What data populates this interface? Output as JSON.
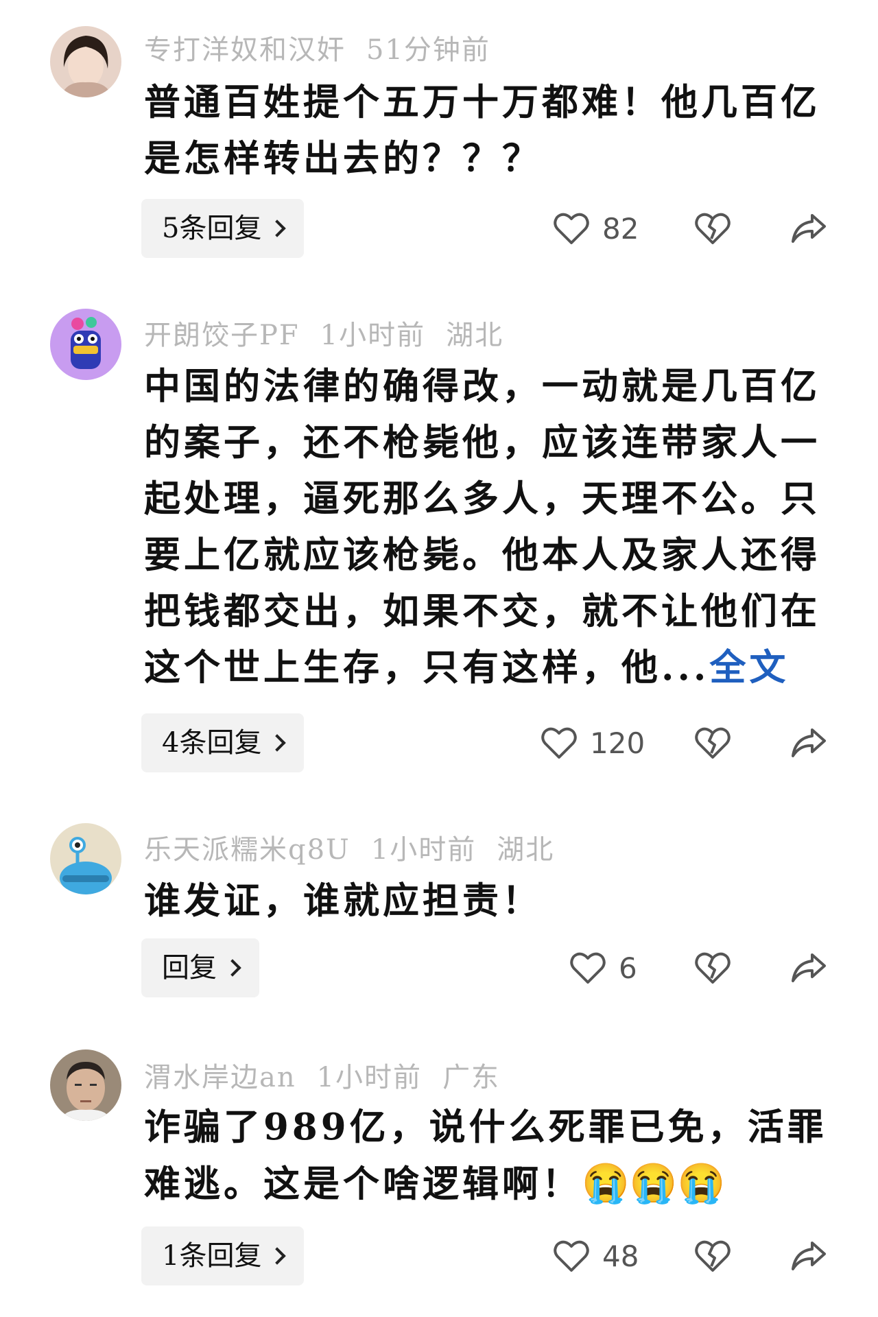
{
  "comments": [
    {
      "username": "专打洋奴和汉奸",
      "time": "51分钟前",
      "location": "",
      "text": "普通百姓提个五万十万都难！他几百亿是怎样转出去的？？？",
      "replies_label": "5条回复",
      "likes": "82"
    },
    {
      "username": "开朗饺子PF",
      "time": "1小时前",
      "location": "湖北",
      "text": "中国的法律的确得改，一动就是几百亿的案子，还不枪毙他，应该连带家人一起处理，逼死那么多人，天理不公。只要上亿就应该枪毙。他本人及家人还得把钱都交出，如果不交，就不让他们在这个世上生存，只有这样，他...",
      "more_label": "全文",
      "replies_label": "4条回复",
      "likes": "120"
    },
    {
      "username": "乐天派糯米q8U",
      "time": "1小时前",
      "location": "湖北",
      "text": "谁发证，谁就应担责！",
      "replies_label": "回复",
      "likes": "6"
    },
    {
      "username": "渭水岸边an",
      "time": "1小时前",
      "location": "广东",
      "text": "诈骗了989亿，说什么死罪已免，活罪难逃。这是个啥逻辑啊！",
      "emoji": "😭😭😭",
      "replies_label": "1条回复",
      "likes": "48"
    }
  ],
  "icons": {
    "like": "heart-outline-icon",
    "dislike": "broken-heart-icon",
    "share": "share-arrow-icon",
    "chevron": "chevron-right-icon"
  },
  "colors": {
    "meta": "#b7b7b7",
    "link": "#1f5fbf",
    "reply_bg": "#f2f2f2",
    "icon": "#555555"
  }
}
